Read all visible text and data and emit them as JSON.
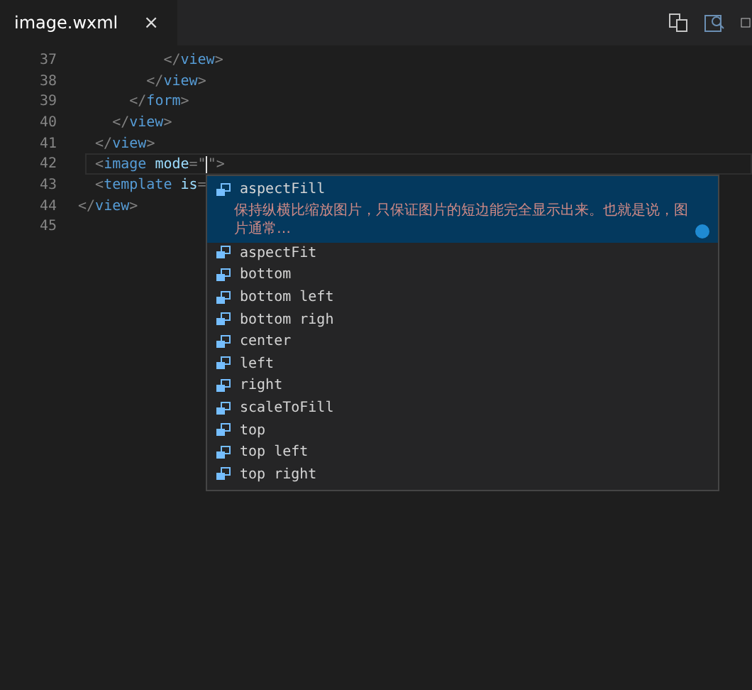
{
  "tabs": [
    {
      "label": "image.wxml",
      "close": "×",
      "selected": true
    }
  ],
  "editor": {
    "lines": [
      {
        "number": "37",
        "current": false,
        "tokens": [
          {
            "kind": "punct",
            "text": "          </"
          },
          {
            "kind": "tag",
            "text": "view"
          },
          {
            "kind": "punct",
            "text": ">"
          }
        ]
      },
      {
        "number": "38",
        "current": false,
        "tokens": [
          {
            "kind": "punct",
            "text": "        </"
          },
          {
            "kind": "tag",
            "text": "view"
          },
          {
            "kind": "punct",
            "text": ">"
          }
        ]
      },
      {
        "number": "39",
        "current": false,
        "tokens": [
          {
            "kind": "punct",
            "text": "      </"
          },
          {
            "kind": "tag",
            "text": "form"
          },
          {
            "kind": "punct",
            "text": ">"
          }
        ]
      },
      {
        "number": "40",
        "current": false,
        "tokens": [
          {
            "kind": "punct",
            "text": "    </"
          },
          {
            "kind": "tag",
            "text": "view"
          },
          {
            "kind": "punct",
            "text": ">"
          }
        ]
      },
      {
        "number": "41",
        "current": false,
        "tokens": [
          {
            "kind": "punct",
            "text": "  </"
          },
          {
            "kind": "tag",
            "text": "view"
          },
          {
            "kind": "punct",
            "text": ">"
          }
        ]
      },
      {
        "number": "42",
        "current": true,
        "tokens": [
          {
            "kind": "punct",
            "text": "  <"
          },
          {
            "kind": "tag",
            "text": "image"
          },
          {
            "kind": "attr",
            "text": " mode"
          },
          {
            "kind": "punct",
            "text": "=\""
          },
          {
            "kind": "cursor"
          },
          {
            "kind": "punct",
            "text": "\">"
          }
        ]
      },
      {
        "number": "43",
        "current": false,
        "tokens": [
          {
            "kind": "punct",
            "text": "  <"
          },
          {
            "kind": "tag",
            "text": "template"
          },
          {
            "kind": "attr",
            "text": " is"
          },
          {
            "kind": "punct",
            "text": "="
          }
        ]
      },
      {
        "number": "44",
        "current": false,
        "tokens": [
          {
            "kind": "punct",
            "text": "</"
          },
          {
            "kind": "tag",
            "text": "view"
          },
          {
            "kind": "punct",
            "text": ">"
          }
        ]
      },
      {
        "number": "45",
        "current": false
      }
    ]
  },
  "suggestions": [
    {
      "label": "aspectFill",
      "selected": true,
      "detail": "保持纵横比缩放图片，只保证图片的短边能完全显示出来。也就是说，图片通常…"
    },
    {
      "label": "aspectFit",
      "selected": false
    },
    {
      "label": "bottom",
      "selected": false
    },
    {
      "label": "bottom left",
      "selected": false
    },
    {
      "label": "bottom righ",
      "selected": false
    },
    {
      "label": "center",
      "selected": false
    },
    {
      "label": "left",
      "selected": false
    },
    {
      "label": "right",
      "selected": false
    },
    {
      "label": "scaleToFill",
      "selected": false
    },
    {
      "label": "top",
      "selected": false
    },
    {
      "label": "top left",
      "selected": false
    },
    {
      "label": "top right",
      "selected": false
    }
  ]
}
